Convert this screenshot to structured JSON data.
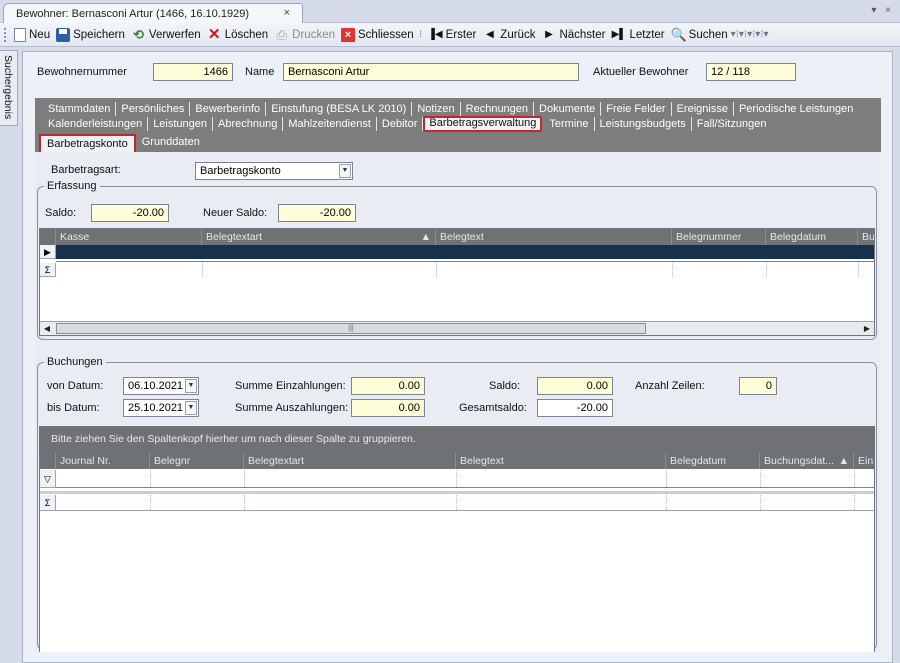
{
  "tab": {
    "title": "Bewohner: Bernasconi Artur (1466, 16.10.1929)",
    "close": "×"
  },
  "window_controls": "▾ ×",
  "toolbar": {
    "new": "Neu",
    "save": "Speichern",
    "discard": "Verwerfen",
    "delete": "Löschen",
    "print": "Drucken",
    "close": "Schliessen",
    "first": "Erster",
    "back": "Zurück",
    "next": "Nächster",
    "last": "Letzter",
    "search": "Suchen"
  },
  "side_tab": "Suchergebnis",
  "header": {
    "resident_number_label": "Bewohnernummer",
    "resident_number": "1466",
    "name_label": "Name",
    "name": "Bernasconi Artur",
    "current_label": "Aktueller Bewohner",
    "current": "12 / 118"
  },
  "tabs_row1": [
    "Stammdaten",
    "Persönliches",
    "Bewerberinfo",
    "Einstufung (BESA LK 2010)",
    "Notizen",
    "Rechnungen",
    "Dokumente",
    "Freie Felder",
    "Ereignisse",
    "Periodische Leistungen"
  ],
  "tabs_row2": [
    "Kalenderleistungen",
    "Leistungen",
    "Abrechnung",
    "Mahlzeitendienst",
    "Debitor",
    "Barbetragsverwaltung",
    "Termine",
    "Leistungsbudgets",
    "Fall/Sitzungen"
  ],
  "subtabs": [
    "Barbetragskonto",
    "Grunddaten"
  ],
  "barbetrag": {
    "type_label": "Barbetragsart:",
    "type_value": "Barbetragskonto"
  },
  "erfassung": {
    "legend": "Erfassung",
    "saldo_label": "Saldo:",
    "saldo": "-20.00",
    "new_saldo_label": "Neuer Saldo:",
    "new_saldo": "-20.00",
    "columns": [
      "Kasse",
      "Belegtextart",
      "Belegtext",
      "Belegnummer",
      "Belegdatum",
      "Bu"
    ],
    "sum_symbol": "Σ",
    "row_marker": "▶"
  },
  "buchungen": {
    "legend": "Buchungen",
    "from_label": "von Datum:",
    "from": "06.10.2021",
    "to_label": "bis Datum:",
    "to": "25.10.2021",
    "sum_in_label": "Summe Einzahlungen:",
    "sum_in": "0.00",
    "sum_out_label": "Summe Auszahlungen:",
    "sum_out": "0.00",
    "saldo_label": "Saldo:",
    "saldo": "0.00",
    "total_label": "Gesamtsaldo:",
    "total": "-20.00",
    "rows_label": "Anzahl Zeilen:",
    "rows": "0",
    "group_hint": "Bitte ziehen Sie den Spaltenkopf hierher um nach dieser Spalte zu gruppieren.",
    "columns": [
      "Journal Nr.",
      "Belegnr",
      "Belegtextart",
      "Belegtext",
      "Belegdatum",
      "Buchungsdat...",
      "Ein"
    ]
  }
}
